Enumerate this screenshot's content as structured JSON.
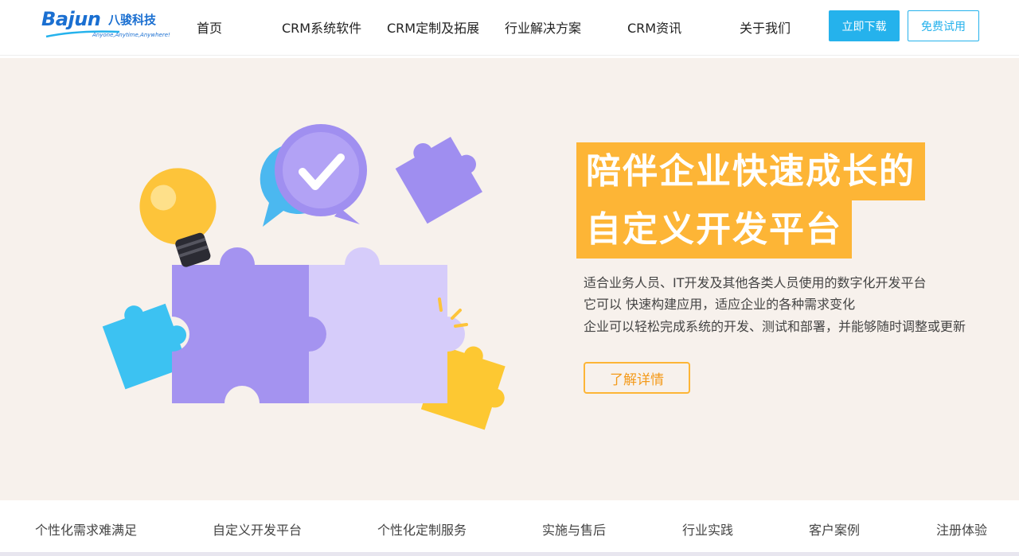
{
  "header": {
    "logo": {
      "brand": "Bajun",
      "cn": "八骏科技",
      "slogan": "Anyone,Anytime,Anywhere!"
    },
    "nav": [
      {
        "label": "首页"
      },
      {
        "label": "CRM系统软件"
      },
      {
        "label": "CRM定制及拓展"
      },
      {
        "label": "行业解决方案"
      },
      {
        "label": "CRM资讯"
      },
      {
        "label": "关于我们"
      }
    ],
    "download_label": "立即下载",
    "trial_label": "免费试用"
  },
  "hero": {
    "headline_line1": "陪伴企业快速成长的",
    "headline_line2": "自定义开发平台",
    "description": [
      "适合业务人员、IT开发及其他各类人员使用的数字化开发平台",
      "它可以 快速构建应用，适应企业的各种需求变化",
      "企业可以轻松完成系统的开发、测试和部署，并能够随时调整或更新"
    ],
    "more_label": "了解详情",
    "illustration_icons": [
      "puzzle-piece-icon",
      "light-bulb-icon",
      "speech-bubble-check-icon"
    ]
  },
  "bottom_nav": [
    {
      "label": "个性化需求难满足"
    },
    {
      "label": "自定义开发平台"
    },
    {
      "label": "个性化定制服务"
    },
    {
      "label": "实施与售后"
    },
    {
      "label": "行业实践"
    },
    {
      "label": "客户案例"
    },
    {
      "label": "注册体验"
    }
  ],
  "colors": {
    "accent_blue": "#25b2ec",
    "brand_blue": "#1a6fd1",
    "headline_orange": "#fdb536",
    "hero_bg": "#f7f1ec",
    "puzzle_purple": "#a493f0",
    "puzzle_lavender": "#d6ccfa",
    "puzzle_cyan": "#3cc2f2",
    "puzzle_yellow": "#fdc832"
  }
}
